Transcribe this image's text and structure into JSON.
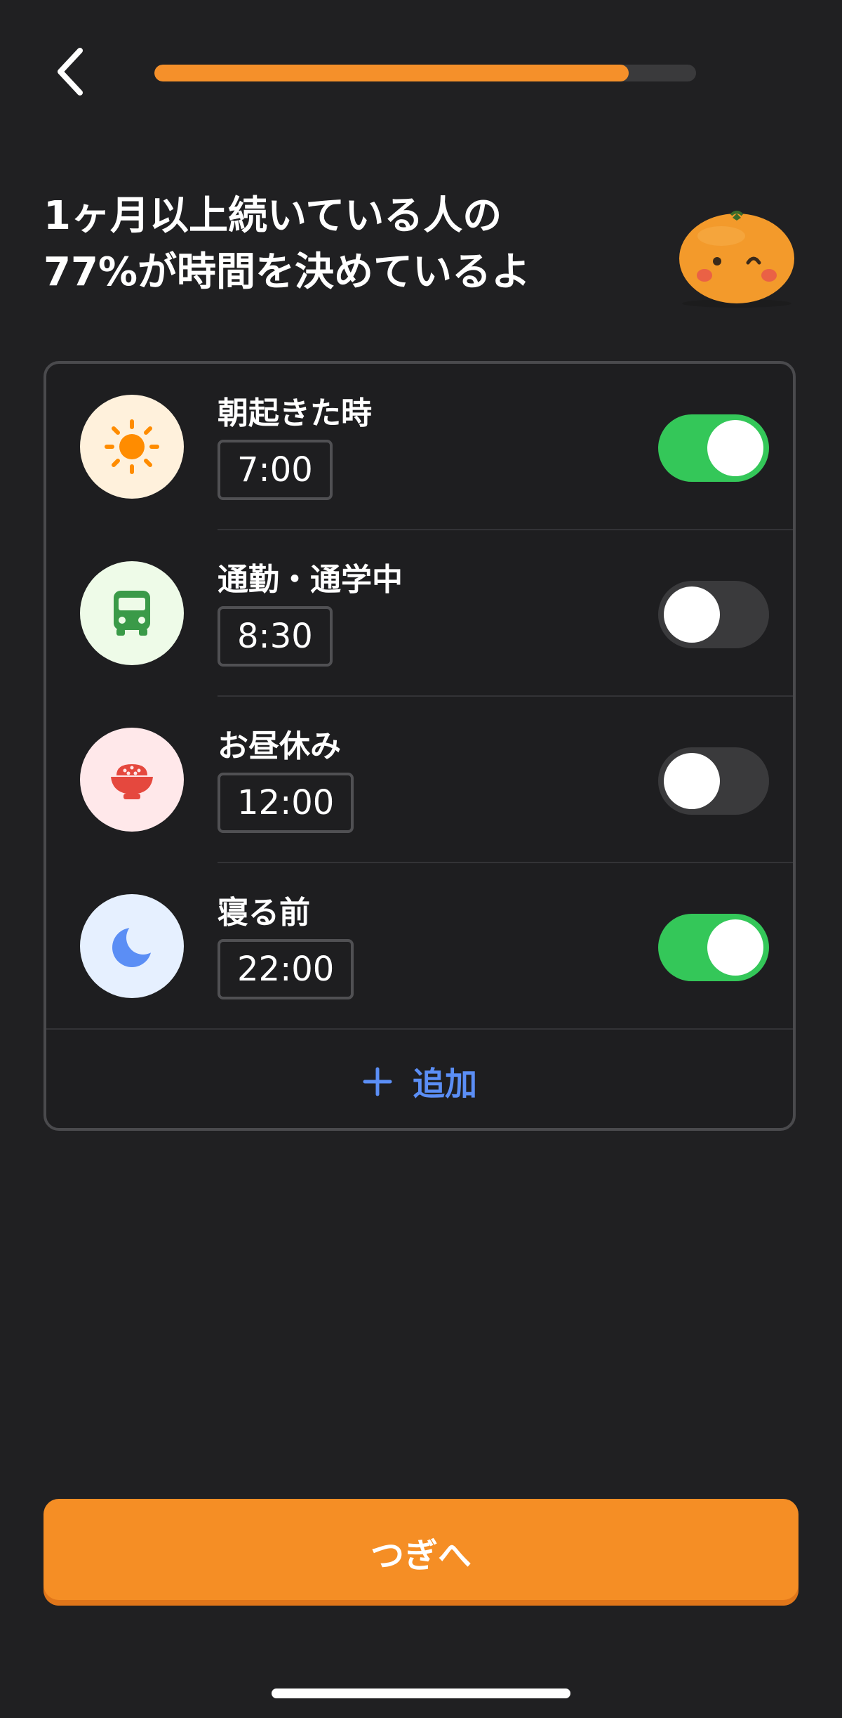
{
  "header": {
    "back_icon": "chevron-left-icon",
    "progress_fraction": 0.875
  },
  "heading": {
    "line1": "1ヶ月以上続いている人の",
    "line2": "77%が時間を決めているよ"
  },
  "mascot": {
    "icon": "orange-mascot-icon"
  },
  "schedule": {
    "items": [
      {
        "label": "朝起きた時",
        "time": "7:00",
        "enabled": true,
        "icon": "sun-icon",
        "icon_bg": "#fff1dc",
        "icon_color": "#ff8c00"
      },
      {
        "label": "通勤・通学中",
        "time": "8:30",
        "enabled": false,
        "icon": "bus-icon",
        "icon_bg": "#eefbe8",
        "icon_color": "#3a9a48"
      },
      {
        "label": "お昼休み",
        "time": "12:00",
        "enabled": false,
        "icon": "rice-bowl-icon",
        "icon_bg": "#ffe8ea",
        "icon_color": "#e5483e"
      },
      {
        "label": "寝る前",
        "time": "22:00",
        "enabled": true,
        "icon": "moon-icon",
        "icon_bg": "#e6f0ff",
        "icon_color": "#5b8ef5"
      }
    ],
    "add_label": "追加",
    "add_icon": "plus-icon"
  },
  "footer": {
    "next_label": "つぎへ"
  },
  "colors": {
    "accent": "#f58e25",
    "toggle_on": "#34c759",
    "toggle_off": "#3a3a3c",
    "link": "#5b8ef5"
  }
}
